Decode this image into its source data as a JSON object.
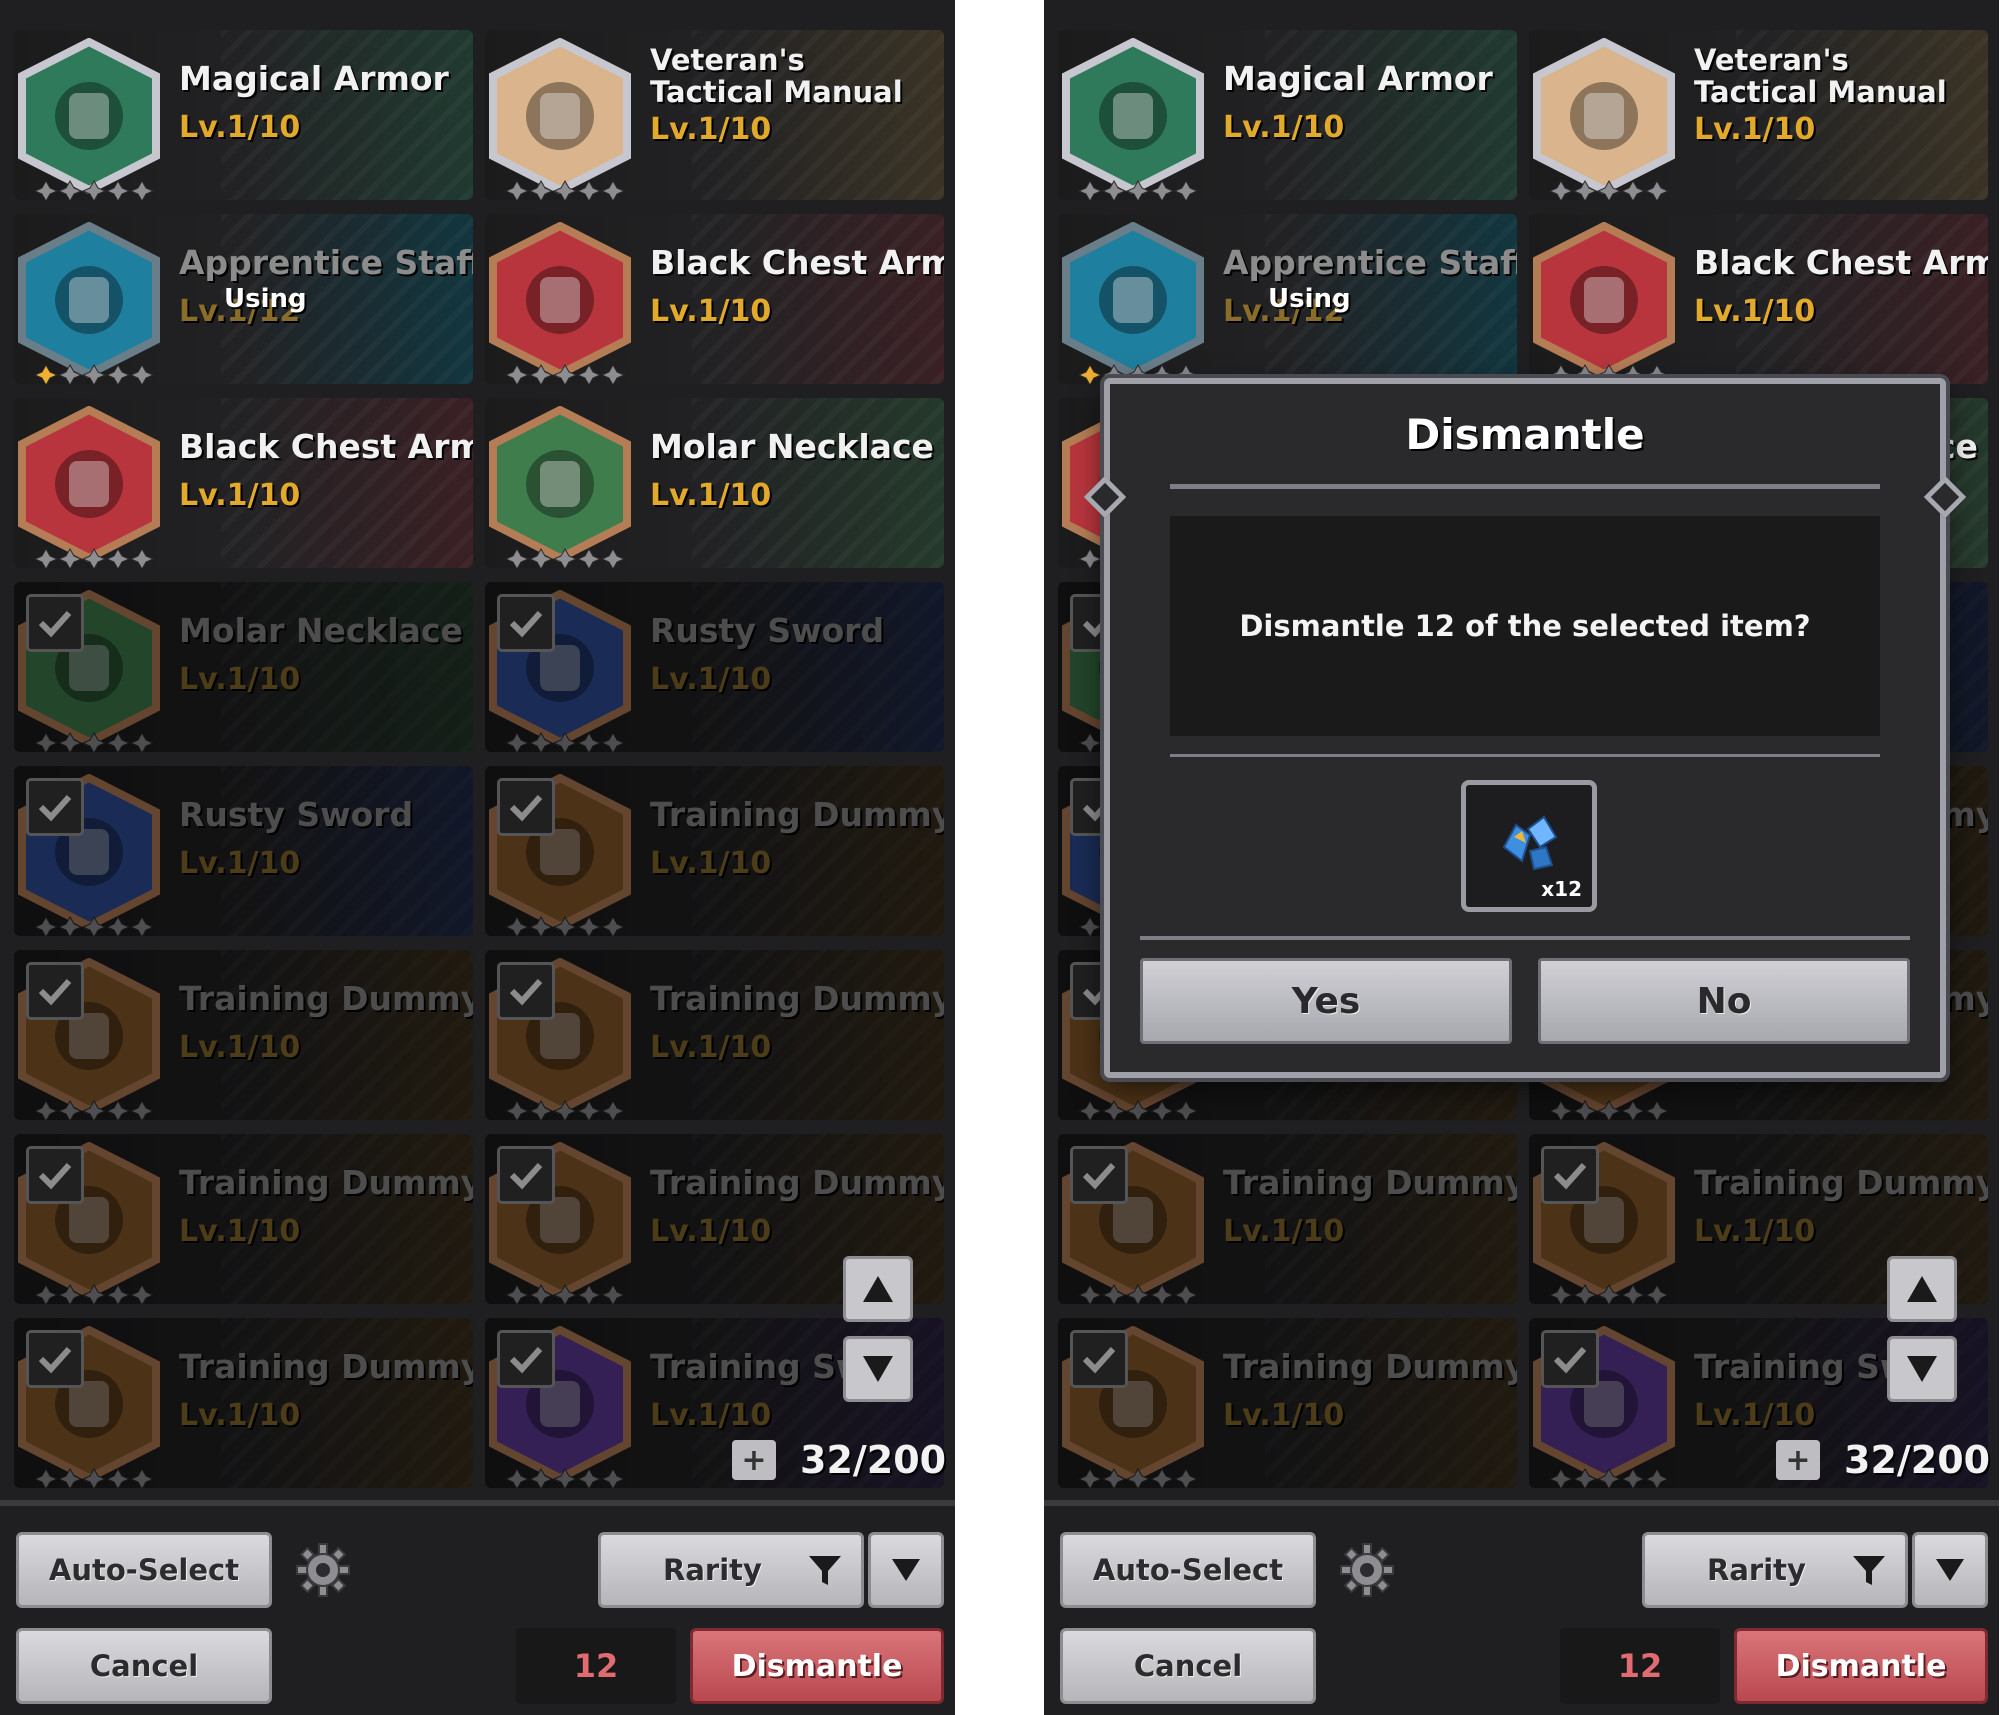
{
  "inventory": {
    "items": [
      {
        "name": "Magical Armor",
        "level": "Lv.1/10",
        "icon": "magical-armor-icon",
        "tint": "#203a30",
        "border": "#c7c7cf",
        "fill": "#2f7a5a",
        "selected": false,
        "badge": ""
      },
      {
        "name": "Veteran's Tactical Manual",
        "level": "Lv.1/10",
        "icon": "tactical-manual-icon",
        "tint": "#3a3325",
        "border": "#c7c7cf",
        "fill": "#d9b48c",
        "selected": false,
        "badge": ""
      },
      {
        "name": "Apprentice Staff",
        "level": "Lv.1/12",
        "icon": "apprentice-staff-icon",
        "tint": "#12363f",
        "border": "#6a7e8a",
        "fill": "#1f7f9e",
        "selected": false,
        "badge": "Using"
      },
      {
        "name": "Black Chest Armor",
        "level": "Lv.1/10",
        "icon": "black-chest-armor-icon",
        "tint": "#3a2024",
        "border": "#b57d55",
        "fill": "#b8353d",
        "selected": false,
        "badge": ""
      },
      {
        "name": "Black Chest Armor",
        "level": "Lv.1/10",
        "icon": "black-chest-armor-icon",
        "tint": "#3a2024",
        "border": "#b57d55",
        "fill": "#b8353d",
        "selected": false,
        "badge": ""
      },
      {
        "name": "Molar Necklace",
        "level": "Lv.1/10",
        "icon": "molar-necklace-icon",
        "tint": "#24392b",
        "border": "#b57d55",
        "fill": "#3f7d4d",
        "selected": false,
        "badge": ""
      },
      {
        "name": "Molar Necklace",
        "level": "Lv.1/10",
        "icon": "molar-necklace-icon",
        "tint": "#24392b",
        "border": "#b57d55",
        "fill": "#3f7d4d",
        "selected": true,
        "badge": ""
      },
      {
        "name": "Rusty Sword",
        "level": "Lv.1/10",
        "icon": "rusty-sword-icon",
        "tint": "#1f2a4a",
        "border": "#b57d55",
        "fill": "#2f4f9b",
        "selected": true,
        "badge": ""
      },
      {
        "name": "Rusty Sword",
        "level": "Lv.1/10",
        "icon": "rusty-sword-icon",
        "tint": "#1f2a4a",
        "border": "#b57d55",
        "fill": "#2f4f9b",
        "selected": true,
        "badge": ""
      },
      {
        "name": "Training Dummy",
        "level": "Lv.1/10",
        "icon": "training-dummy-icon",
        "tint": "#3a2e1c",
        "border": "#b57d55",
        "fill": "#8a5a2a",
        "selected": true,
        "badge": ""
      },
      {
        "name": "Training Dummy",
        "level": "Lv.1/10",
        "icon": "training-dummy-icon",
        "tint": "#3a2e1c",
        "border": "#b57d55",
        "fill": "#8a5a2a",
        "selected": true,
        "badge": ""
      },
      {
        "name": "Training Dummy",
        "level": "Lv.1/10",
        "icon": "training-dummy-icon",
        "tint": "#3a2e1c",
        "border": "#b57d55",
        "fill": "#8a5a2a",
        "selected": true,
        "badge": ""
      },
      {
        "name": "Training Dummy",
        "level": "Lv.1/10",
        "icon": "training-dummy-icon",
        "tint": "#3a2e1c",
        "border": "#b57d55",
        "fill": "#8a5a2a",
        "selected": true,
        "badge": ""
      },
      {
        "name": "Training Dummy",
        "level": "Lv.1/10",
        "icon": "training-dummy-icon",
        "tint": "#3a2e1c",
        "border": "#b57d55",
        "fill": "#8a5a2a",
        "selected": true,
        "badge": ""
      },
      {
        "name": "Training Dummy",
        "level": "Lv.1/10",
        "icon": "training-dummy-icon",
        "tint": "#3a2e1c",
        "border": "#b57d55",
        "fill": "#8a5a2a",
        "selected": true,
        "badge": ""
      },
      {
        "name": "Training Sw",
        "level": "Lv.1/10",
        "icon": "training-sword-icon",
        "tint": "#2a2040",
        "border": "#b57d55",
        "fill": "#5e3a9a",
        "selected": true,
        "badge": ""
      }
    ],
    "capacity": "32/200"
  },
  "toolbar": {
    "auto_select": "Auto-Select",
    "filter_label": "Rarity",
    "cancel": "Cancel",
    "selected_count": "12",
    "dismantle": "Dismantle"
  },
  "dialog": {
    "title": "Dismantle",
    "message": "Dismantle 12 of the selected item?",
    "reward_icon": "crystal-shard-icon",
    "reward_qty": "x12",
    "yes": "Yes",
    "no": "No"
  },
  "colors": {
    "panel_bg": "#1f1f21",
    "level_gold": "#e2a92a",
    "dismantle_red": "#b9484f",
    "count_red": "#e06b70"
  }
}
